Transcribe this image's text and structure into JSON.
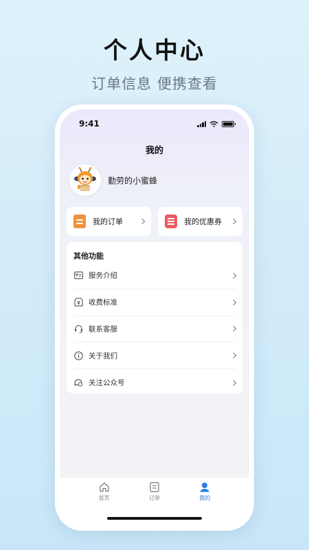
{
  "promo": {
    "headline": "个人中心",
    "subline": "订单信息 便携查看"
  },
  "status_bar": {
    "time": "9:41"
  },
  "page": {
    "title": "我的"
  },
  "profile": {
    "username": "勤劳的小蜜蜂",
    "avatar": "bee-mascot"
  },
  "quick_actions": [
    {
      "label": "我的订单",
      "icon": "order-icon",
      "color": "#f0923c"
    },
    {
      "label": "我的优惠券",
      "icon": "coupon-icon",
      "color": "#ec5a63"
    }
  ],
  "other_functions": {
    "title": "其他功能",
    "items": [
      {
        "label": "服务介绍",
        "icon": "id-card-icon"
      },
      {
        "label": "收费标准",
        "icon": "fee-icon"
      },
      {
        "label": "联系客服",
        "icon": "headset-icon"
      },
      {
        "label": "关于我们",
        "icon": "info-icon"
      },
      {
        "label": "关注公众号",
        "icon": "chat-icon"
      }
    ]
  },
  "tabbar": {
    "items": [
      {
        "label": "首页",
        "icon": "home-icon",
        "active": false
      },
      {
        "label": "订单",
        "icon": "order-list-icon",
        "active": false
      },
      {
        "label": "我的",
        "icon": "user-icon",
        "active": true
      }
    ],
    "active_color": "#2a7be0"
  }
}
